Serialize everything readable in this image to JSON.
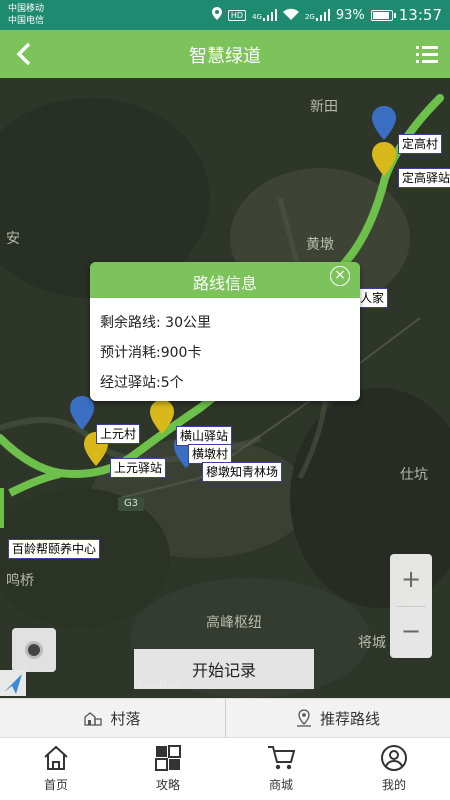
{
  "status_bar": {
    "carrier_1": "中国移动",
    "carrier_2": "中国电信",
    "hd": "HD",
    "net_1": "4G",
    "net_2": "2G",
    "battery": "93%",
    "battery_level": 0.93,
    "time": "13:57"
  },
  "header": {
    "title": "智慧绿道",
    "back_icon": "back-arrow-icon",
    "menu_icon": "list-menu-icon"
  },
  "map": {
    "place_names": [
      "新田",
      "黄墩",
      "仕坑",
      "高峰枢纽",
      "将城",
      "安",
      "鸣桥"
    ],
    "poi_labels": [
      "定高村",
      "定高驿站",
      "人家",
      "上元村",
      "上元驿站",
      "横山驿站",
      "横墩村",
      "穆墩知青林场",
      "百龄帮颐养中心"
    ],
    "road_badge": "G3",
    "watermark": "AutoNavi",
    "zoom_in": "+",
    "zoom_out": "−",
    "route_color": "#6dc14b",
    "pin_blue": "#3a6fc4",
    "pin_yellow": "#d8b81a"
  },
  "dialog": {
    "title": "路线信息",
    "rows": [
      "剩余路线: 30公里",
      "预计消耗:900卡",
      "经过驿站:5个"
    ]
  },
  "actions": {
    "start_record": "开始记录",
    "tab_village": "村落",
    "tab_route": "推荐路线"
  },
  "bottom_nav": {
    "items": [
      {
        "label": "首页",
        "icon": "home-icon"
      },
      {
        "label": "攻略",
        "icon": "grid-icon"
      },
      {
        "label": "商城",
        "icon": "cart-icon"
      },
      {
        "label": "我的",
        "icon": "user-icon"
      }
    ]
  },
  "colors": {
    "status_bar": "#1e8a6f",
    "header": "#7bc35a",
    "accent_green": "#7bc35a"
  }
}
